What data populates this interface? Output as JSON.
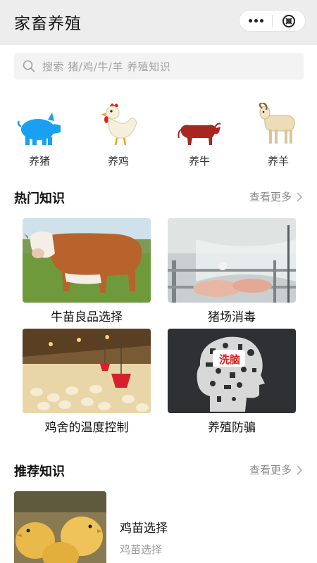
{
  "app": {
    "title": "家畜养殖"
  },
  "search": {
    "placeholder": "搜索 猪/鸡/牛/羊 养殖知识"
  },
  "categories": [
    {
      "label": "养猪",
      "icon": "pig-icon",
      "color": "#1aa0f0"
    },
    {
      "label": "养鸡",
      "icon": "chicken-icon",
      "color": "#f2ead2"
    },
    {
      "label": "养牛",
      "icon": "bull-icon",
      "color": "#a8261f"
    },
    {
      "label": "养羊",
      "icon": "sheep-icon",
      "color": "#e9d9b6"
    }
  ],
  "hot": {
    "title": "热门知识",
    "more": "查看更多",
    "items": [
      {
        "caption": "牛苗良品选择"
      },
      {
        "caption": "猪场消毒"
      },
      {
        "caption": "鸡舍的温度控制"
      },
      {
        "caption": "养殖防骗",
        "badge": "洗脑"
      }
    ]
  },
  "recommend": {
    "title": "推荐知识",
    "more": "查看更多",
    "items": [
      {
        "title": "鸡苗选择",
        "subtitle": "鸡苗选择"
      }
    ]
  }
}
